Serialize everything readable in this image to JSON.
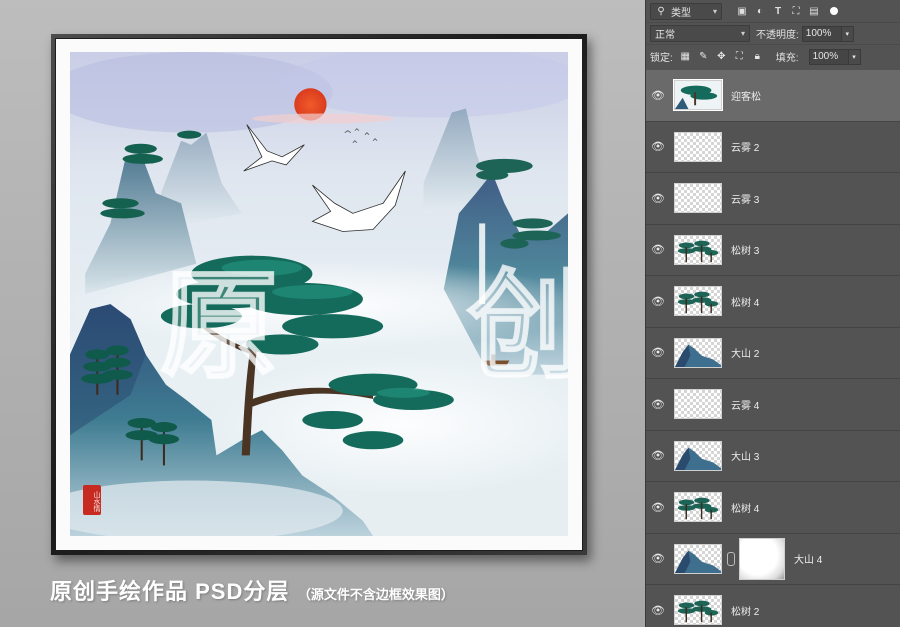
{
  "artwork": {
    "watermark": "原 创",
    "seal_text": "山水情"
  },
  "caption": {
    "main": "原创手绘作品  PSD分层",
    "note": "（源文件不含边框效果图）"
  },
  "layers_panel": {
    "filter": {
      "label": "类型",
      "icon": "search-icon"
    },
    "filter_icons": [
      "image-filter-icon",
      "adjustment-filter-icon",
      "type-filter-icon",
      "shape-filter-icon",
      "smart-object-filter-icon"
    ],
    "blend_mode": "正常",
    "opacity_label": "不透明度:",
    "opacity_value": "100%",
    "lock_label": "锁定:",
    "fill_label": "填充:",
    "fill_value": "100%",
    "layers": [
      {
        "name": "迎客松",
        "selected": true,
        "thumb": "pine-full"
      },
      {
        "name": "云雾 2",
        "thumb": "transparent"
      },
      {
        "name": "云雾 3",
        "thumb": "transparent"
      },
      {
        "name": "松树 3",
        "thumb": "pines"
      },
      {
        "name": "松树 4",
        "thumb": "pines"
      },
      {
        "name": "大山 2",
        "thumb": "mountain"
      },
      {
        "name": "云雾 4",
        "thumb": "transparent"
      },
      {
        "name": "大山 3",
        "thumb": "mountain"
      },
      {
        "name": "松树 4",
        "thumb": "pines"
      },
      {
        "name": "大山 4",
        "thumb": "mountain",
        "has_mask": true
      },
      {
        "name": "松树 2",
        "thumb": "pines"
      }
    ]
  }
}
